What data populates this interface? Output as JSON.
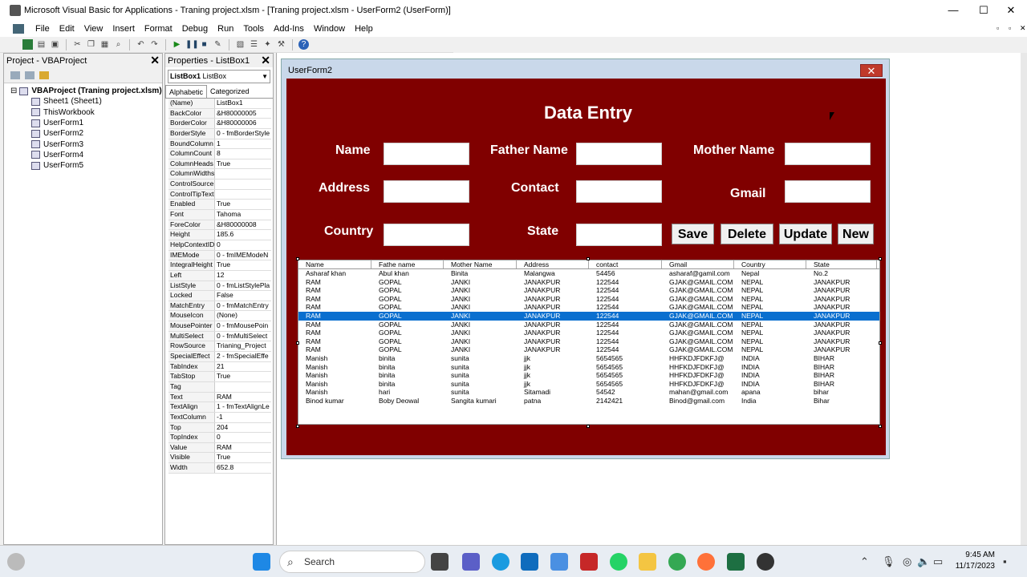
{
  "window": {
    "title": "Microsoft Visual Basic for Applications - Traning project.xlsm - [Traning project.xlsm - UserForm2 (UserForm)]",
    "minimize": "—",
    "maximize": "☐",
    "close": "✕"
  },
  "menu": [
    "File",
    "Edit",
    "View",
    "Insert",
    "Format",
    "Debug",
    "Run",
    "Tools",
    "Add-Ins",
    "Window",
    "Help"
  ],
  "project_pane": {
    "title": "Project - VBAProject",
    "close": "✕",
    "tree": [
      {
        "label": "VBAProject (Traning project.xlsm)",
        "level": 0,
        "bold": true
      },
      {
        "label": "Sheet1 (Sheet1)",
        "level": 1
      },
      {
        "label": "ThisWorkbook",
        "level": 1
      },
      {
        "label": "UserForm1",
        "level": 1
      },
      {
        "label": "UserForm2",
        "level": 1
      },
      {
        "label": "UserForm3",
        "level": 1
      },
      {
        "label": "UserForm4",
        "level": 1
      },
      {
        "label": "UserForm5",
        "level": 1
      }
    ]
  },
  "properties_pane": {
    "title": "Properties - ListBox1",
    "close": "✕",
    "object": "ListBox1",
    "object_type": "ListBox",
    "tabs": [
      "Alphabetic",
      "Categorized"
    ],
    "rows": [
      [
        "(Name)",
        "ListBox1"
      ],
      [
        "BackColor",
        "&H80000005"
      ],
      [
        "BorderColor",
        "&H80000006"
      ],
      [
        "BorderStyle",
        "0 - fmBorderStyle"
      ],
      [
        "BoundColumn",
        "1"
      ],
      [
        "ColumnCount",
        "8"
      ],
      [
        "ColumnHeads",
        "True"
      ],
      [
        "ColumnWidths",
        ""
      ],
      [
        "ControlSource",
        ""
      ],
      [
        "ControlTipText",
        ""
      ],
      [
        "Enabled",
        "True"
      ],
      [
        "Font",
        "Tahoma"
      ],
      [
        "ForeColor",
        "&H80000008"
      ],
      [
        "Height",
        "185.6"
      ],
      [
        "HelpContextID",
        "0"
      ],
      [
        "IMEMode",
        "0 - fmIMEModeN"
      ],
      [
        "IntegralHeight",
        "True"
      ],
      [
        "Left",
        "12"
      ],
      [
        "ListStyle",
        "0 - fmListStylePla"
      ],
      [
        "Locked",
        "False"
      ],
      [
        "MatchEntry",
        "0 - fmMatchEntry"
      ],
      [
        "MouseIcon",
        "(None)"
      ],
      [
        "MousePointer",
        "0 - fmMousePoin"
      ],
      [
        "MultiSelect",
        "0 - fmMultiSelect"
      ],
      [
        "RowSource",
        "Trianing_Project"
      ],
      [
        "SpecialEffect",
        "2 - fmSpecialEffe"
      ],
      [
        "TabIndex",
        "21"
      ],
      [
        "TabStop",
        "True"
      ],
      [
        "Tag",
        ""
      ],
      [
        "Text",
        "RAM"
      ],
      [
        "TextAlign",
        "1 - fmTextAlignLe"
      ],
      [
        "TextColumn",
        "-1"
      ],
      [
        "Top",
        "204"
      ],
      [
        "TopIndex",
        "0"
      ],
      [
        "Value",
        "RAM"
      ],
      [
        "Visible",
        "True"
      ],
      [
        "Width",
        "652.8"
      ]
    ]
  },
  "userform": {
    "title": "UserForm2",
    "close": "✕",
    "heading": "Data Entry",
    "labels": {
      "name": "Name",
      "father": "Father Name",
      "mother": "Mother Name",
      "address": "Address",
      "contact": "Contact",
      "gmail": "Gmail",
      "country": "Country",
      "state": "State"
    },
    "buttons": {
      "save": "Save",
      "delete": "Delete",
      "update": "Update",
      "new": "New"
    },
    "colors": {
      "form_bg": "#800000",
      "selection": "#0a6fcf"
    },
    "list": {
      "columns": [
        "Name",
        "Fathe name",
        "Mother Name",
        "Address",
        "contact",
        "Gmail",
        "Country",
        "State"
      ],
      "rows": [
        [
          "Asharaf khan",
          "Abul khan",
          "Binita",
          "Malangwa",
          "54456",
          "asharaf@gamil.com",
          "Nepal",
          "No.2"
        ],
        [
          "RAM",
          "GOPAL",
          "JANKI",
          "JANAKPUR",
          "122544",
          "GJAK@GMAIL.COM",
          "NEPAL",
          "JANAKPUR"
        ],
        [
          "RAM",
          "GOPAL",
          "JANKI",
          "JANAKPUR",
          "122544",
          "GJAK@GMAIL.COM",
          "NEPAL",
          "JANAKPUR"
        ],
        [
          "RAM",
          "GOPAL",
          "JANKI",
          "JANAKPUR",
          "122544",
          "GJAK@GMAIL.COM",
          "NEPAL",
          "JANAKPUR"
        ],
        [
          "RAM",
          "GOPAL",
          "JANKI",
          "JANAKPUR",
          "122544",
          "GJAK@GMAIL.COM",
          "NEPAL",
          "JANAKPUR"
        ],
        [
          "RAM",
          "GOPAL",
          "JANKI",
          "JANAKPUR",
          "122544",
          "GJAK@GMAIL.COM",
          "NEPAL",
          "JANAKPUR"
        ],
        [
          "RAM",
          "GOPAL",
          "JANKI",
          "JANAKPUR",
          "122544",
          "GJAK@GMAIL.COM",
          "NEPAL",
          "JANAKPUR"
        ],
        [
          "RAM",
          "GOPAL",
          "JANKI",
          "JANAKPUR",
          "122544",
          "GJAK@GMAIL.COM",
          "NEPAL",
          "JANAKPUR"
        ],
        [
          "RAM",
          "GOPAL",
          "JANKI",
          "JANAKPUR",
          "122544",
          "GJAK@GMAIL.COM",
          "NEPAL",
          "JANAKPUR"
        ],
        [
          "RAM",
          "GOPAL",
          "JANKI",
          "JANAKPUR",
          "122544",
          "GJAK@GMAIL.COM",
          "NEPAL",
          "JANAKPUR"
        ],
        [
          "Manish",
          "binita",
          "sunita",
          "jjk",
          "5654565",
          "HHFKDJFDKFJ@",
          "INDIA",
          "BIHAR"
        ],
        [
          "Manish",
          "binita",
          "sunita",
          "jjk",
          "5654565",
          "HHFKDJFDKFJ@",
          "INDIA",
          "BIHAR"
        ],
        [
          "Manish",
          "binita",
          "sunita",
          "jjk",
          "5654565",
          "HHFKDJFDKFJ@",
          "INDIA",
          "BIHAR"
        ],
        [
          "Manish",
          "binita",
          "sunita",
          "jjk",
          "5654565",
          "HHFKDJFDKFJ@",
          "INDIA",
          "BIHAR"
        ],
        [
          "Manish",
          "hari",
          "sunita",
          "Sitamadi",
          "54542",
          "mahan@gmail.com",
          "apana",
          "bihar"
        ],
        [
          "Binod kumar",
          "Boby Deowal",
          "Sangita kumari",
          "patna",
          "2142421",
          "Binod@gmail.com",
          "India",
          "Bihar"
        ]
      ],
      "selected_index": 5
    }
  },
  "taskbar": {
    "search": "Search",
    "time": "9:45 AM",
    "date": "11/17/2023"
  }
}
